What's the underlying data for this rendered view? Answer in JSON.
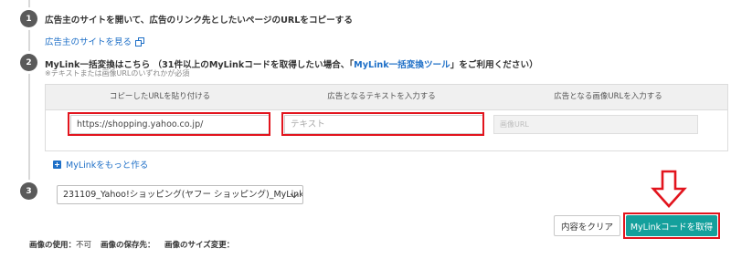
{
  "steps": [
    {
      "number": "1",
      "heading": "広告主のサイトを開いて、広告のリンク先としたいページのURLをコピーする"
    },
    {
      "number": "2",
      "heading_before": "MyLink一括変換はこちら （31件以上のMyLinkコードを取得したい場合、「",
      "heading_link": "MyLink一括変換ツール",
      "heading_after": "」をご利用ください）",
      "note": "※テキストまたは画像URLのいずれかが必須"
    },
    {
      "number": "3"
    }
  ],
  "advertiser_link": "広告主のサイトを見る",
  "table": {
    "headers": [
      "コピーしたURLを貼り付ける",
      "広告となるテキストを入力する",
      "広告となる画像URLを入力する"
    ],
    "url_value": "https://shopping.yahoo.co.jp/",
    "text_placeholder": "テキスト",
    "image_placeholder": "画像URL"
  },
  "more_link": "MyLinkをもっと作る",
  "select_value": "231109_Yahoo!ショッピング(ヤフー ショッピング)_MyLink",
  "buttons": {
    "clear": "内容をクリア",
    "get_code": "MyLinkコードを取得"
  },
  "footer": {
    "usage_label": "画像の使用：",
    "usage_value": "不可",
    "storage_label": "画像の保存先：",
    "resize_label": "画像のサイズ変更："
  },
  "colors": {
    "highlight": "#e2141d",
    "primary": "#14a09c",
    "link": "#1e6fc7"
  },
  "icons": [
    "external-link-icon",
    "plus-square-icon",
    "chevron-down-icon",
    "down-arrow-icon"
  ]
}
